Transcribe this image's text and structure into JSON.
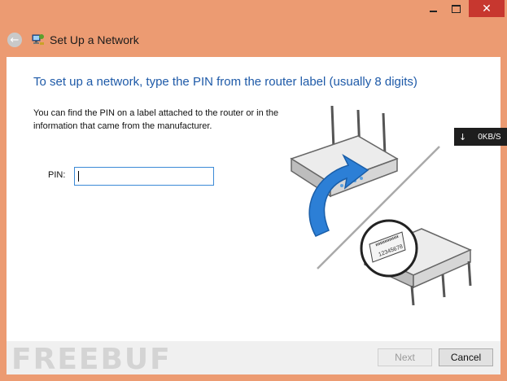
{
  "window": {
    "title": "Set Up a Network",
    "controls": {
      "minimize": "",
      "maximize": "",
      "close": "✕"
    },
    "back_icon": "back-arrow-icon"
  },
  "main": {
    "heading": "To set up a network, type the PIN from the router label (usually 8 digits)",
    "description": "You can find the PIN on a label attached to the router or in the information that came from the manufacturer.",
    "pin_label": "PIN:",
    "pin_value": "",
    "pin_placeholder": ""
  },
  "illustration": {
    "label_text": "12345678"
  },
  "footer": {
    "next_label": "Next",
    "cancel_label": "Cancel"
  },
  "network_monitor": {
    "arrow": "↓",
    "speed": "0KB/S"
  },
  "watermark": "FREEBUF"
}
